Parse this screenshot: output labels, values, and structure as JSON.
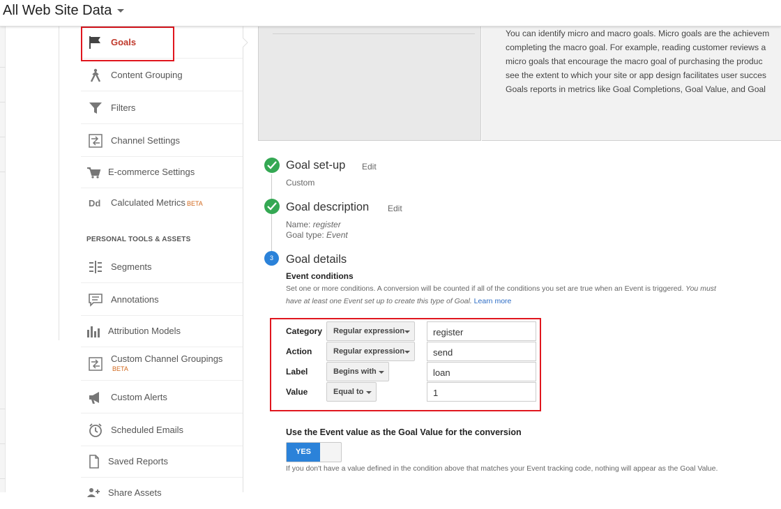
{
  "header": {
    "view_title": "All Web Site Data"
  },
  "nav": {
    "items": [
      {
        "label": "Goals",
        "icon": "flag-icon",
        "active": true
      },
      {
        "label": "Content Grouping",
        "icon": "person-walking-icon"
      },
      {
        "label": "Filters",
        "icon": "funnel-icon"
      },
      {
        "label": "Channel Settings",
        "icon": "channel-settings-icon"
      },
      {
        "label": "E-commerce Settings",
        "icon": "cart-icon"
      },
      {
        "label": "Calculated Metrics",
        "badge": "BETA",
        "icon": "dd-icon"
      }
    ],
    "section_heading": "PERSONAL TOOLS & ASSETS",
    "personal_items": [
      {
        "label": "Segments",
        "icon": "segments-icon"
      },
      {
        "label": "Annotations",
        "icon": "comment-icon"
      },
      {
        "label": "Attribution Models",
        "icon": "bar-chart-icon"
      },
      {
        "label": "Custom Channel Groupings",
        "badge": "BETA",
        "icon": "channel-settings-icon"
      },
      {
        "label": "Custom Alerts",
        "icon": "megaphone-icon"
      },
      {
        "label": "Scheduled Emails",
        "icon": "clock-icon"
      },
      {
        "label": "Saved Reports",
        "icon": "document-icon"
      },
      {
        "label": "Share Assets",
        "icon": "share-people-icon"
      }
    ]
  },
  "intro": {
    "lines": [
      "You can identify micro and macro goals. Micro goals are the achievem",
      "completing the macro goal. For example, reading customer reviews a",
      "micro goals that encourage the macro goal of purchasing the produc",
      "see the extent to which your site or app design facilitates user succes",
      "Goals reports in metrics like Goal Completions, Goal Value, and Goal"
    ]
  },
  "steps": {
    "setup": {
      "title": "Goal set-up",
      "edit": "Edit",
      "value": "Custom"
    },
    "description": {
      "title": "Goal description",
      "edit": "Edit",
      "name_label": "Name:",
      "name_value": "register",
      "type_label": "Goal type:",
      "type_value": "Event"
    },
    "details": {
      "number": "3",
      "title": "Goal details"
    }
  },
  "conditions": {
    "title": "Event conditions",
    "desc": "Set one or more conditions. A conversion will be counted if all of the conditions you set are true when an Event is triggered.",
    "desc_italic": "You must have at least one Event set up to create this type of Goal.",
    "learn_more": "Learn more",
    "rows": [
      {
        "label": "Category",
        "operator": "Regular expression",
        "value": "register"
      },
      {
        "label": "Action",
        "operator": "Regular expression",
        "value": "send"
      },
      {
        "label": "Label",
        "operator": "Begins with",
        "value": "loan"
      },
      {
        "label": "Value",
        "operator": "Equal to",
        "value": "1"
      }
    ]
  },
  "event_value": {
    "title": "Use the Event value as the Goal Value for the conversion",
    "toggle_label": "YES",
    "toggle_on": true,
    "note": "If you don't have a value defined in the condition above that matches your Event tracking code, nothing will appear as the Goal Value."
  },
  "colors": {
    "accent_red": "#e0161e",
    "check_green": "#34a853",
    "primary_blue": "#2b82d9",
    "active_text": "#c0392b"
  }
}
